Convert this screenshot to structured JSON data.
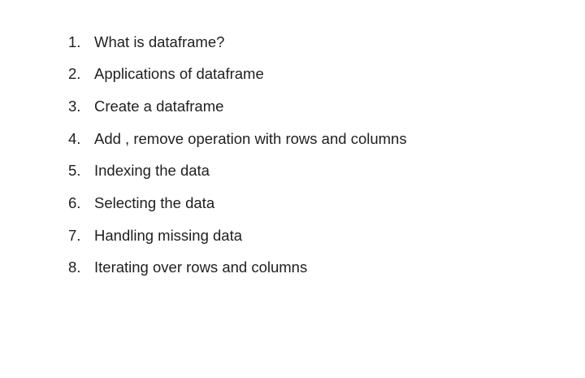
{
  "topics": [
    {
      "number": "1.",
      "text": "What is dataframe?"
    },
    {
      "number": "2.",
      "text": "Applications of dataframe"
    },
    {
      "number": "3.",
      "text": "Create a dataframe"
    },
    {
      "number": "4.",
      "text": "Add , remove operation with rows and columns"
    },
    {
      "number": "5.",
      "text": "Indexing the data"
    },
    {
      "number": "6.",
      "text": "Selecting the data"
    },
    {
      "number": "7.",
      "text": "Handling missing data"
    },
    {
      "number": "8.",
      "text": "Iterating over rows and columns"
    }
  ]
}
